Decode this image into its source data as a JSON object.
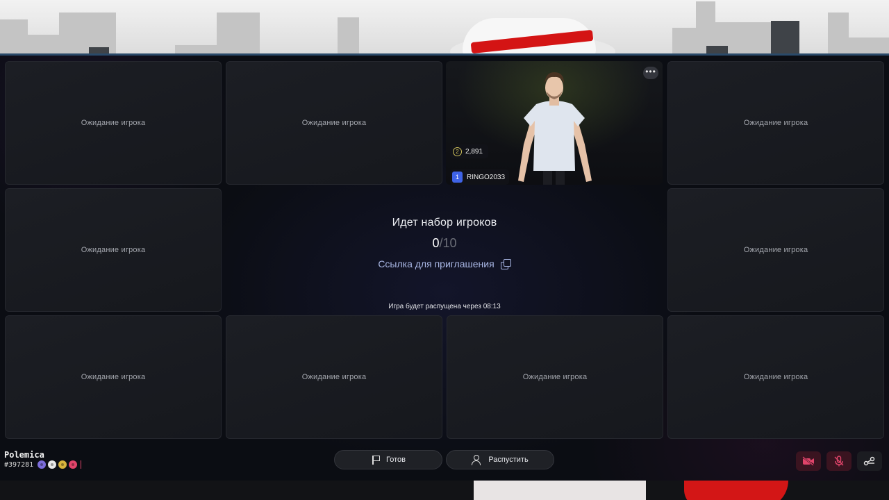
{
  "lobby": {
    "waiting_label": "Ожидание игрока",
    "title": "Идет набор игроков",
    "players_current": "0",
    "players_separator": "/",
    "players_max": "10",
    "invite_link_label": "Ссылка для приглашения",
    "disband_timer_text": "Игра будет распущена через 08:13"
  },
  "player": {
    "coins": "2,891",
    "coin_level": "2",
    "seat_number": "1",
    "nickname": "RINGO2033",
    "more_label": "•••"
  },
  "profile": {
    "name": "Polemica",
    "id": "#397281"
  },
  "buttons": {
    "ready_label": "Готов",
    "disband_label": "Распустить"
  },
  "icons": {
    "more": "more-horizontal-icon",
    "coin": "coin-icon",
    "copy": "copy-icon",
    "flag": "flag-icon",
    "disband": "user-remove-icon",
    "camera_off": "camera-off-icon",
    "mic_off": "mic-off-icon",
    "settings": "settings-icon"
  },
  "colors": {
    "accent_link": "#aab8e6",
    "seat_badge": "#3f63e6",
    "muted_red": "#e0446a"
  }
}
